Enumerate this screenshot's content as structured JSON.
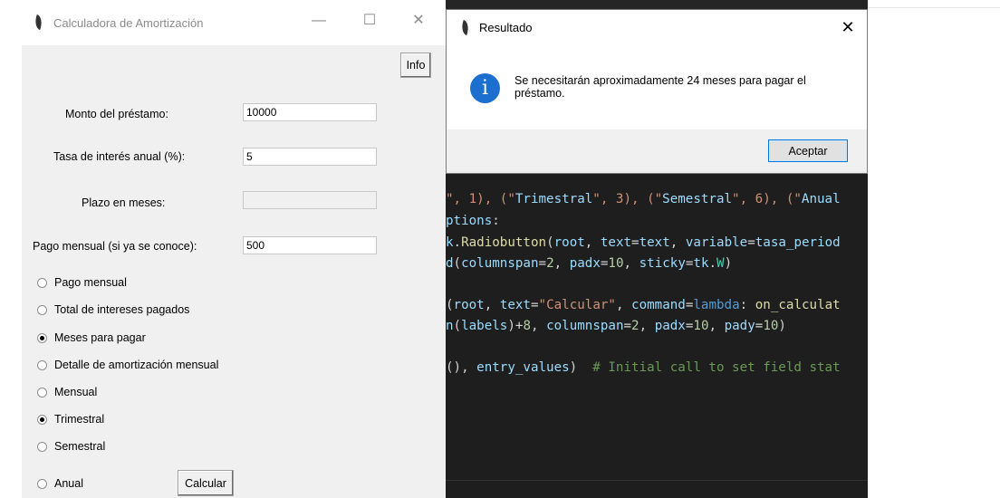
{
  "main_window": {
    "title": "Calculadora de Amortización",
    "controls": {
      "minimize": "—",
      "maximize": "☐",
      "close": "✕"
    },
    "info_button": "Info",
    "fields": [
      {
        "label": "Monto del préstamo:",
        "value": "10000",
        "disabled": false
      },
      {
        "label": "Tasa de interés anual (%):",
        "value": "5",
        "disabled": false
      },
      {
        "label": "Plazo en meses:",
        "value": "",
        "disabled": true
      },
      {
        "label": "Pago mensual (si ya se conoce):",
        "value": "500",
        "disabled": false
      }
    ],
    "calc_options": [
      {
        "label": "Pago mensual",
        "selected": false
      },
      {
        "label": "Total de intereses pagados",
        "selected": false
      },
      {
        "label": "Meses para pagar",
        "selected": true
      },
      {
        "label": "Detalle de amortización mensual",
        "selected": false
      }
    ],
    "period_options": [
      {
        "label": "Mensual",
        "selected": false
      },
      {
        "label": "Trimestral",
        "selected": true
      },
      {
        "label": "Semestral",
        "selected": false
      },
      {
        "label": "Anual",
        "selected": false
      }
    ],
    "calculate_button": "Calcular"
  },
  "dialog": {
    "title": "Resultado",
    "close": "✕",
    "icon": "info-icon",
    "icon_glyph": "i",
    "message": "Se necesitarán aproximadamente 24 meses para pagar el préstamo.",
    "ok_button": "Aceptar"
  },
  "editor": {
    "lines": [
      "\", 1), (\"Trimestral\", 3), (\"Semestral\", 6), (\"Anual",
      "ptions:",
      "k.Radiobutton(root, text=text, variable=tasa_period",
      "d(columnspan=2, padx=10, sticky=tk.W)",
      "",
      "(root, text=\"Calcular\", command=lambda: on_calculat",
      "n(labels)+8, columnspan=2, padx=10, pady=10)",
      "",
      "(), entry_values)  # Initial call to set field stat"
    ]
  },
  "colors": {
    "window_bg": "#f0f0f0",
    "editor_bg": "#1e1e1e",
    "info_icon": "#1c6fce",
    "default_button_border": "#0078d7"
  }
}
